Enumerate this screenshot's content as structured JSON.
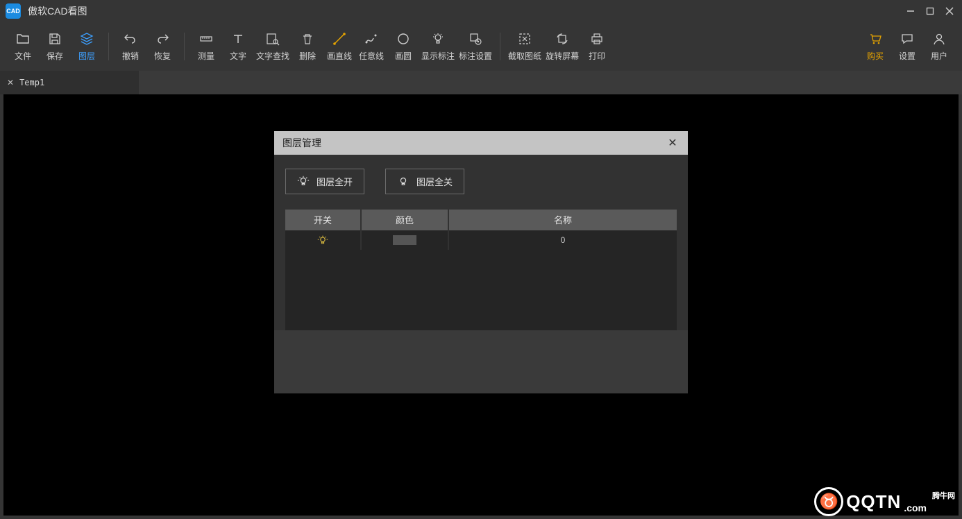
{
  "app": {
    "title": "傲软CAD看图",
    "iconText": "CAD"
  },
  "toolbar": {
    "left": [
      {
        "id": "file",
        "label": "文件"
      },
      {
        "id": "save",
        "label": "保存"
      },
      {
        "id": "layers",
        "label": "图层",
        "active": true
      }
    ],
    "mid1": [
      {
        "id": "undo",
        "label": "撤销"
      },
      {
        "id": "redo",
        "label": "恢复"
      }
    ],
    "mid2": [
      {
        "id": "measure",
        "label": "测量"
      },
      {
        "id": "text",
        "label": "文字"
      },
      {
        "id": "textfind",
        "label": "文字查找"
      },
      {
        "id": "delete",
        "label": "删除"
      },
      {
        "id": "line",
        "label": "画直线"
      },
      {
        "id": "polyline",
        "label": "任意线"
      },
      {
        "id": "circle",
        "label": "画圆"
      },
      {
        "id": "showannot",
        "label": "显示标注"
      },
      {
        "id": "annotset",
        "label": "标注设置"
      }
    ],
    "mid3": [
      {
        "id": "capture",
        "label": "截取图纸"
      },
      {
        "id": "rotate",
        "label": "旋转屏幕"
      },
      {
        "id": "print",
        "label": "打印"
      }
    ],
    "right": [
      {
        "id": "buy",
        "label": "购买",
        "accent": true
      },
      {
        "id": "settings",
        "label": "设置"
      },
      {
        "id": "user",
        "label": "用户"
      }
    ]
  },
  "tab": {
    "label": "Temp1"
  },
  "dialog": {
    "title": "图层管理",
    "allOn": "图层全开",
    "allOff": "图层全关",
    "cols": {
      "switch": "开关",
      "color": "颜色",
      "name": "名称"
    },
    "row": {
      "name": "0"
    }
  },
  "watermark": {
    "main": "QQTN",
    "com": ".com",
    "cn": "腾牛网"
  }
}
